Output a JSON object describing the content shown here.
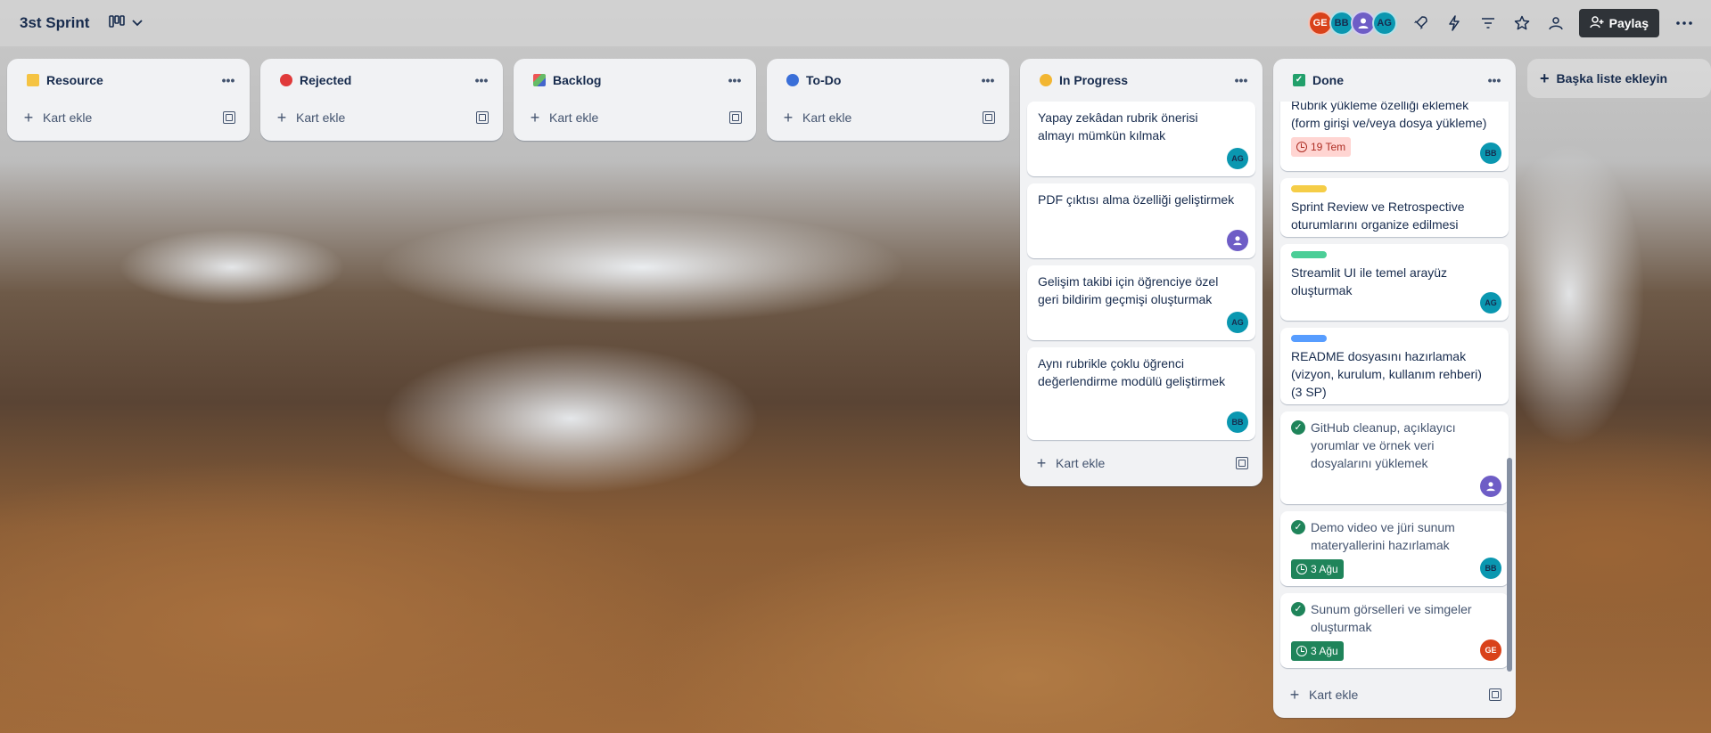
{
  "header": {
    "board_title": "3st Sprint",
    "share_label": "Paylaş",
    "members": [
      {
        "initials": "GE",
        "color": "#d9421a"
      },
      {
        "initials": "BB",
        "color": "#0a97b0"
      },
      {
        "initials": "",
        "color": "#6e5dc6"
      },
      {
        "initials": "AG",
        "color": "#0a97b0"
      }
    ]
  },
  "lists": [
    {
      "name": "Resource",
      "icon_color": "#f5c342",
      "add_card": "Kart ekle"
    },
    {
      "name": "Rejected",
      "icon_color": "#e03a3a",
      "add_card": "Kart ekle"
    },
    {
      "name": "Backlog",
      "icon_color": "#8a6fd1",
      "add_card": "Kart ekle"
    },
    {
      "name": "To-Do",
      "icon_color": "#3a6fd8",
      "add_card": "Kart ekle"
    }
  ],
  "in_progress": {
    "name": "In Progress",
    "icon_color": "#f2b632",
    "add_card": "Kart ekle",
    "cards": [
      {
        "title": "Yapay zekâdan rubrik önerisi almayı mümkün kılmak",
        "member": "AG"
      },
      {
        "title": "PDF çıktısı alma özelliği geliştirmek",
        "member": ""
      },
      {
        "title": "Gelişim takibi için öğrenciye özel geri bildirim geçmişi oluşturmak",
        "member": "AG"
      },
      {
        "title": "Aynı rubrikle çoklu öğrenci değerlendirme modülü geliştirmek",
        "member": "BB"
      }
    ]
  },
  "done": {
    "name": "Done",
    "add_card": "Kart ekle",
    "cards": [
      {
        "title": "Rubrik yükleme özelliği eklemek (form girişi ve/veya dosya yükleme)",
        "due": "19 Tem",
        "member": "BB"
      },
      {
        "label_color": "#f5cd47",
        "title": "Sprint Review ve Retrospective oturumlarını organize edilmesi"
      },
      {
        "label_color": "#4bce97",
        "title": "Streamlit UI ile temel arayüz oluşturmak",
        "member": "AG"
      },
      {
        "label_color": "#579dff",
        "title": "README dosyasını hazırlamak (vizyon, kurulum, kullanım rehberi)(3 SP)"
      },
      {
        "title": "GitHub cleanup, açıklayıcı yorumlar ve örnek veri dosyalarını yüklemek",
        "member": ""
      },
      {
        "title": "Demo video ve jüri sunum materyallerini hazırlamak",
        "due": "3 Ağu",
        "member": "BB"
      },
      {
        "title": "Sunum görselleri ve simgeler oluşturmak",
        "due": "3 Ağu",
        "member": "GE"
      }
    ]
  },
  "add_list_label": "Başka liste ekleyin"
}
